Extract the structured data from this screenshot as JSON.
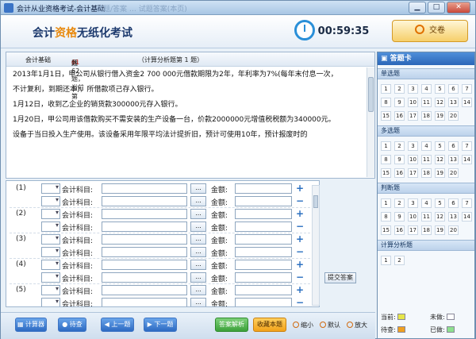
{
  "window": {
    "title": "会计从业资格考试-会计基础",
    "ghost_tabs": "试题/答案 … 试题答案(本页)",
    "min": "▁",
    "max": "□",
    "close": "✕"
  },
  "header": {
    "brand_main": "会计从业资格",
    "brand_rest": "无纸化考试",
    "brand_lead": "会计",
    "timer": "00:59:35",
    "submit": "交卷"
  },
  "question": {
    "subject": "会计基础",
    "count_prefix": "共62题，当前第",
    "current": "61",
    "count_suffix": "题",
    "section": "（计算分析题第 1 题）",
    "paragraphs": [
      "2013年1月1日，甲公司从银行借入资金2 700 000元借款期限为2年，年利率为7%(每年末付息一次，",
      "不计复利，到期还本)，所借款项己存入银行。",
      "1月12日，收到乙企业的销货款300000元存入银行。",
      "1月20日，甲公司用该借款购买不需安装的生产设备一台，价款2000000元增值税税额为340000元。",
      "设备于当日投入生产使用。该设备采用年限平均法计提折旧，预计可使用10年，预计报废时的"
    ]
  },
  "entries": {
    "account_label": "会计科目:",
    "amount_label": "金额:",
    "dots": "...",
    "plus": "+",
    "minus": "−",
    "groups": [
      "(1)",
      "(2)",
      "(3)",
      "(4)",
      "(5)"
    ],
    "post_button": "提交答案"
  },
  "toolbar": {
    "calculator": "计算器",
    "pending": "待查",
    "prev": "上一题",
    "next": "下一题",
    "analysis": "答案解析",
    "collect": "收藏本题",
    "zoom_out": "缩小",
    "default": "默认",
    "zoom_in": "放大"
  },
  "card": {
    "title": "答题卡",
    "sections": [
      {
        "name": "单选题",
        "numbers": [
          "1",
          "2",
          "3",
          "4",
          "5",
          "6",
          "7",
          "8",
          "9",
          "10",
          "11",
          "12",
          "13",
          "14",
          "15",
          "16",
          "17",
          "18",
          "19",
          "20"
        ]
      },
      {
        "name": "多选题",
        "numbers": [
          "1",
          "2",
          "3",
          "4",
          "5",
          "6",
          "7",
          "8",
          "9",
          "10",
          "11",
          "12",
          "13",
          "14",
          "15",
          "16",
          "17",
          "18",
          "19",
          "20"
        ]
      },
      {
        "name": "判断题",
        "numbers": [
          "1",
          "2",
          "3",
          "4",
          "5",
          "6",
          "7",
          "8",
          "9",
          "10",
          "11",
          "12",
          "13",
          "14",
          "15",
          "16",
          "17",
          "18",
          "19",
          "20"
        ]
      },
      {
        "name": "计算分析题",
        "numbers": [
          "1",
          "2"
        ]
      }
    ],
    "legend": {
      "current": "当前:",
      "unanswered": "未做:",
      "pending": "待查:",
      "answered": "已做:"
    },
    "colors": {
      "current": "#e6e64a",
      "unanswered": "#ffffff",
      "pending": "#f0a020",
      "answered": "#8ee08e"
    }
  }
}
